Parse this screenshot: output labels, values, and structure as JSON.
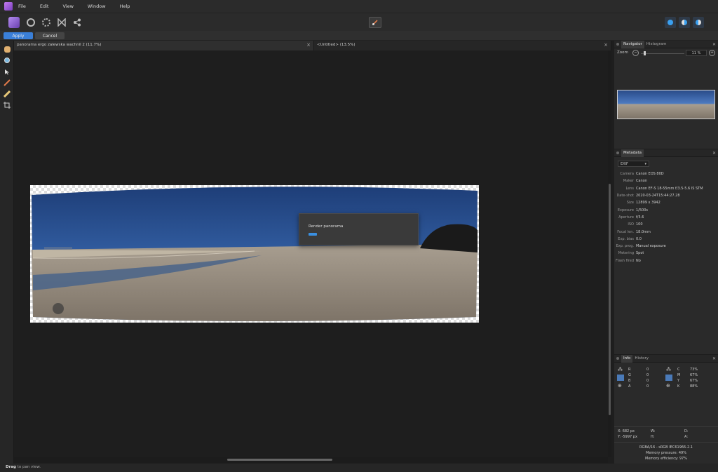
{
  "menu": [
    "File",
    "Edit",
    "View",
    "Window",
    "Help"
  ],
  "context": {
    "apply": "Apply",
    "cancel": "Cancel"
  },
  "tabs": [
    {
      "title": "panorama ergo zalewska wachnil 2 (11.7%)",
      "close": "×"
    },
    {
      "title": "<Untitled> (13.5%)",
      "close": "×"
    }
  ],
  "dialog": {
    "label": "Render panorama",
    "progress": 0.08
  },
  "status": {
    "bold": "Drag",
    "rest": "to pan view."
  },
  "navigator": {
    "tab_active": "Navigator",
    "tab_other": "Histogram",
    "zoom_label": "Zoom",
    "zoom_value": "11 %"
  },
  "metadata": {
    "tab": "Metadata",
    "dropdown": "EXIF",
    "rows": [
      {
        "key": "Camera",
        "value": "Canon EOS 80D"
      },
      {
        "key": "Maker",
        "value": "Canon"
      },
      {
        "key": "Lens",
        "value": "Canon EF-S 18-55mm f/3.5-5.6 IS STM"
      },
      {
        "key": "Date-shot",
        "value": "2020-03-24T15:44:27.28"
      },
      {
        "key": "Size",
        "value": "12899 x 3942"
      },
      {
        "key": "Exposure",
        "value": "1/500s"
      },
      {
        "key": "Aperture",
        "value": "f/5.6"
      },
      {
        "key": "ISO",
        "value": "100"
      },
      {
        "key": "Focal len.",
        "value": "18.0mm"
      },
      {
        "key": "Exp. bias",
        "value": "0.0"
      },
      {
        "key": "Exp. prog.",
        "value": "Manual exposure"
      },
      {
        "key": "Metering",
        "value": "Spot"
      },
      {
        "key": "Flash fired",
        "value": "No"
      }
    ]
  },
  "info": {
    "tab_active": "Info",
    "tab_other": "History",
    "rgb": [
      {
        "k": "R",
        "v": "0"
      },
      {
        "k": "G",
        "v": "0"
      },
      {
        "k": "B",
        "v": "0"
      },
      {
        "k": "A",
        "v": "0"
      }
    ],
    "cmyk": [
      {
        "k": "C",
        "v": "73%"
      },
      {
        "k": "M",
        "v": "67%"
      },
      {
        "k": "Y",
        "v": "67%"
      },
      {
        "k": "K",
        "v": "88%"
      }
    ],
    "coords": {
      "x": "X: 682 px",
      "y": "Y: -5997 px",
      "w": "W:",
      "h": "H:"
    },
    "format": "RGBA/16 - sRGB IEC61966-2.1",
    "mem_pressure": "Memory pressure: 49%",
    "mem_efficiency": "Memory efficiency: 97%"
  }
}
